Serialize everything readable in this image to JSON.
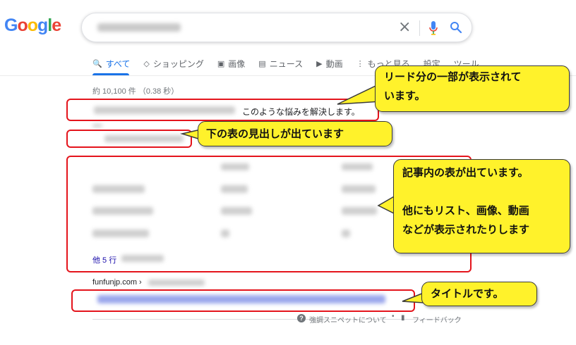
{
  "logo": {
    "c1": "G",
    "c2": "o",
    "c3": "o",
    "c4": "g",
    "c5": "l",
    "c6": "e"
  },
  "tabs": [
    {
      "icon": "🔍",
      "label": "すべて"
    },
    {
      "icon": "◇",
      "label": "ショッピング"
    },
    {
      "icon": "▣",
      "label": "画像"
    },
    {
      "icon": "▤",
      "label": "ニュース"
    },
    {
      "icon": "▶",
      "label": "動画"
    },
    {
      "icon": "⋮",
      "label": "もっと見る"
    },
    {
      "icon": "",
      "label": "設定"
    },
    {
      "icon": "",
      "label": "ツール"
    }
  ],
  "result_stats": "約 10,100 件 （0.38 秒）",
  "snippet": {
    "text": "このような悩みを解決します。",
    "more_rows": "他 5 行"
  },
  "site_name": "funfunjp.com ›",
  "feedback": {
    "about": "強調スニペットについて",
    "bullet": "•",
    "label": "フィードバック"
  },
  "callouts": {
    "lead": "リード分の一部が表示されて\nいます。",
    "heading": "下の表の見出しが出ています",
    "table": "記事内の表が出ています。\n\n他にもリスト、画像、動画\nなどが表示されたりします",
    "title": "タイトルです。"
  },
  "colors": {
    "highlight": "#e4141c",
    "callout_bg": "#fff22b",
    "link_blue": "#1a0dab",
    "tab_active": "#1a73e8"
  },
  "icons": {
    "clear": "×",
    "mic": "mic-icon",
    "search": "search-icon",
    "help": "?",
    "flag": "▮"
  }
}
